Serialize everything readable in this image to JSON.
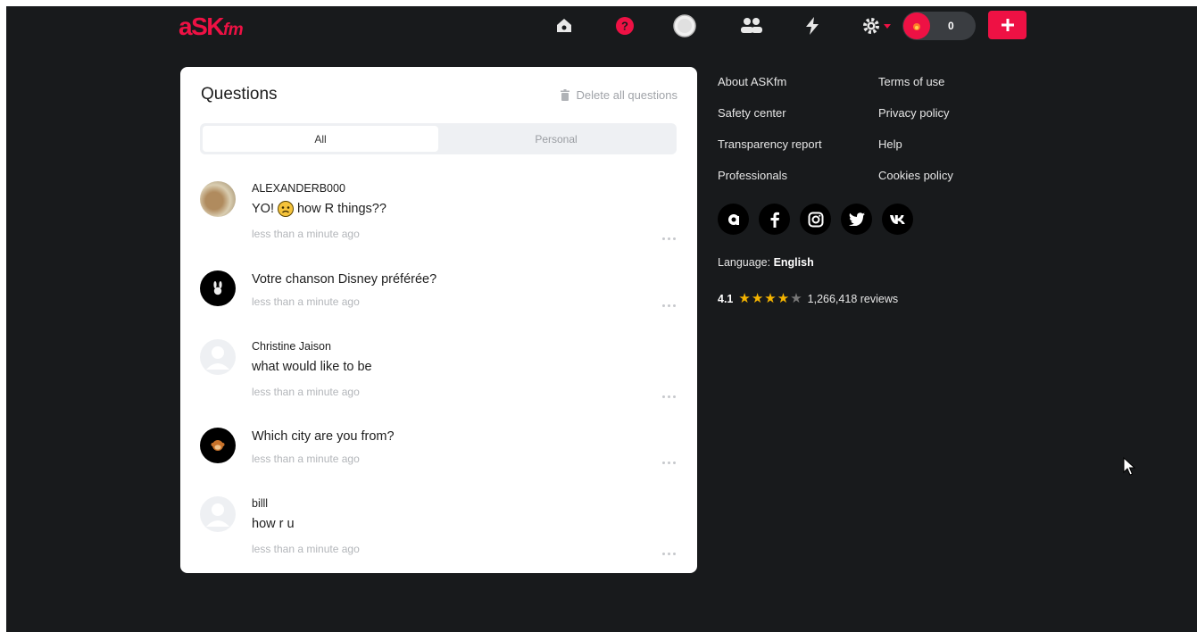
{
  "brand": {
    "logo_main": "aSK",
    "logo_suffix": "fm",
    "accent": "#ee1144"
  },
  "header": {
    "nav_icons": [
      "home-icon",
      "question-icon",
      "profile-avatar",
      "friends-icon",
      "activity-icon",
      "settings-icon"
    ],
    "streak_count": "0"
  },
  "questions": {
    "title": "Questions",
    "delete_all_label": "Delete all questions",
    "tabs": [
      {
        "label": "All",
        "active": true
      },
      {
        "label": "Personal",
        "active": false
      }
    ],
    "items": [
      {
        "user": "ALEXANDERB000",
        "text_before": "YO!",
        "emoji": "sad-face-emoji",
        "text_after": "how R things??",
        "time": "less than a minute ago"
      },
      {
        "user": "",
        "text": "Votre chanson Disney préférée?",
        "time": "less than a minute ago"
      },
      {
        "user": "Christine Jaison",
        "text": "what would like to be",
        "time": "less than a minute ago"
      },
      {
        "user": "",
        "text": "Which city are you from?",
        "time": "less than a minute ago"
      },
      {
        "user": "billl",
        "text": "how r u",
        "time": "less than a minute ago"
      }
    ]
  },
  "footer": {
    "links_left": [
      "About ASKfm",
      "Safety center",
      "Transparency report",
      "Professionals"
    ],
    "links_right": [
      "Terms of use",
      "Privacy policy",
      "Help",
      "Cookies policy"
    ],
    "social": [
      "askfm-icon",
      "facebook-icon",
      "instagram-icon",
      "twitter-icon",
      "vk-icon"
    ],
    "language_label": "Language:",
    "language_value": "English",
    "rating_value": "4.1",
    "rating_stars": 4,
    "reviews_label": "1,266,418 reviews"
  }
}
